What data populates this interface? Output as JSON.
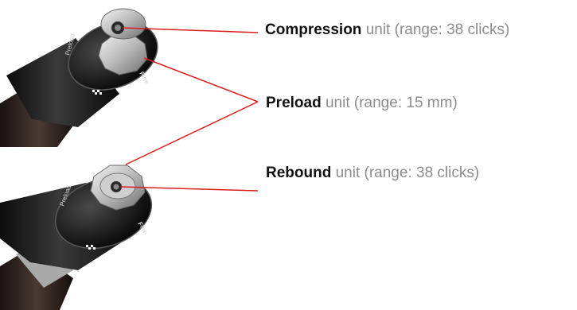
{
  "labels": {
    "compression": {
      "name": "Compression",
      "desc": "unit (range: 38 clicks)"
    },
    "preload": {
      "name": "Preload",
      "desc": "unit (range: 15 mm)"
    },
    "rebound": {
      "name": "Rebound",
      "desc": "unit (range: 38 clicks)"
    }
  },
  "colors": {
    "leader_line": "#e01b1b",
    "label_name": "#111111",
    "label_desc": "#8c8c8c"
  },
  "knob_marking": "Fine",
  "knob_side_text": "Preload"
}
